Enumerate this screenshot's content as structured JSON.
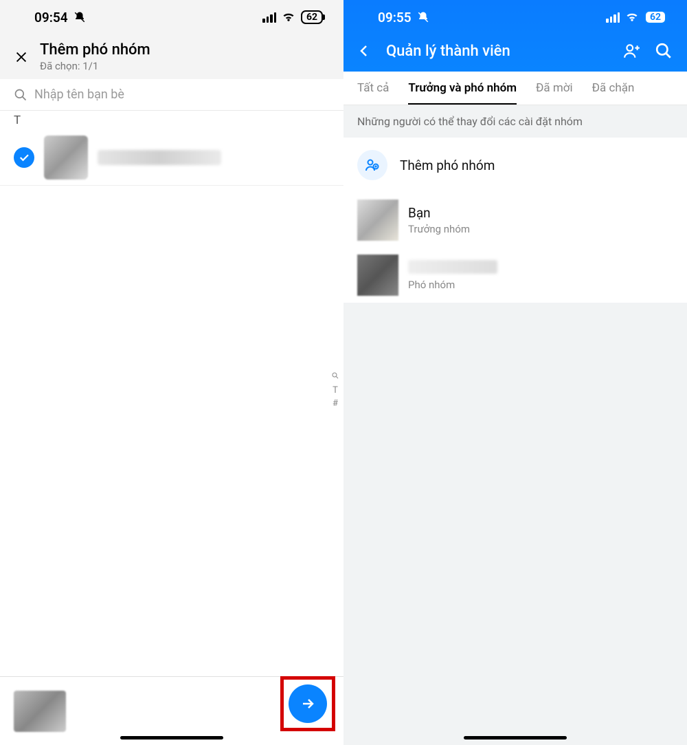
{
  "left": {
    "status": {
      "time": "09:54",
      "battery": "62"
    },
    "header": {
      "title": "Thêm phó nhóm",
      "subtitle": "Đã chọn: 1/1"
    },
    "search": {
      "placeholder": "Nhập tên bạn bè"
    },
    "section_letter": "T",
    "alpha_index": {
      "letter": "T",
      "hash": "#"
    }
  },
  "right": {
    "status": {
      "time": "09:55",
      "battery": "62"
    },
    "header": {
      "title": "Quản lý thành viên"
    },
    "tabs": {
      "all": "Tất cả",
      "leaders": "Trưởng và phó nhóm",
      "invited": "Đã mời",
      "blocked": "Đã chặn"
    },
    "banner": "Những người có thể thay đổi các cài đặt nhóm",
    "add_row": {
      "label": "Thêm phó nhóm"
    },
    "members": {
      "me": {
        "name": "Bạn",
        "role": "Trưởng nhóm"
      },
      "deputy": {
        "role": "Phó nhóm"
      }
    }
  }
}
